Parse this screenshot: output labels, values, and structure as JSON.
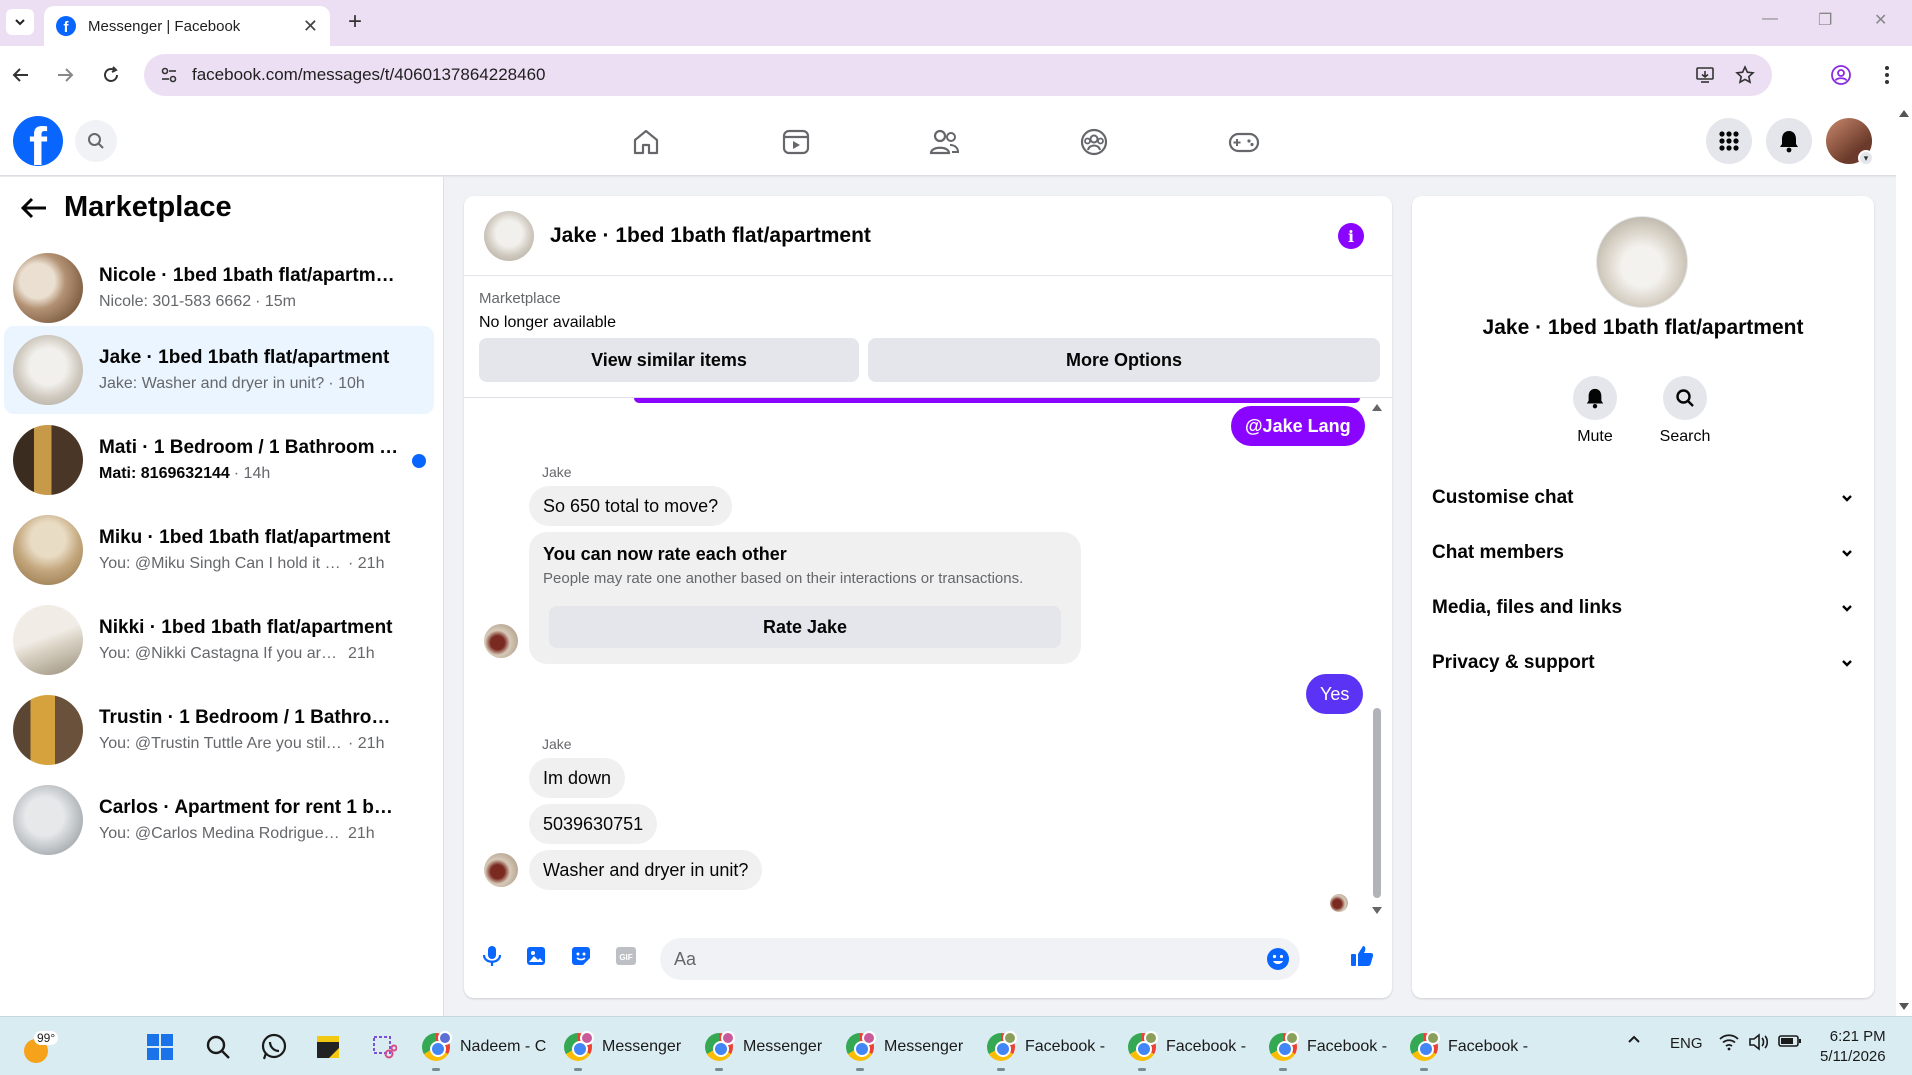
{
  "browser": {
    "tab_title": "Messenger | Facebook",
    "url": "facebook.com/messages/t/4060137864228460"
  },
  "fb": {
    "nav_icons": [
      "home-icon",
      "watch-icon",
      "friends-icon",
      "groups-icon",
      "gaming-icon"
    ]
  },
  "sidebar": {
    "title": "Marketplace",
    "conversations": [
      {
        "name": "Nicole · 1bed 1bath flat/apartment",
        "preview": "Nicole: 301-583 6662",
        "time": "· 15m",
        "unread": false
      },
      {
        "name": "Jake · 1bed 1bath flat/apartment",
        "preview": "Jake: Washer and dryer in unit?",
        "time": "· 10h",
        "unread": false
      },
      {
        "name": "Mati · 1 Bedroom / 1 Bathroom A...",
        "preview": "Mati: 8169632144",
        "time": "· 14h",
        "unread": true
      },
      {
        "name": "Miku · 1bed 1bath flat/apartment",
        "preview": "You: @Miku Singh Can I hold it for y...",
        "time": "· 21h",
        "unread": false
      },
      {
        "name": "Nikki · 1bed 1bath flat/apartment",
        "preview": "You: @Nikki Castagna If you are inter...",
        "time": "21h",
        "unread": false
      },
      {
        "name": "Trustin · 1 Bedroom / 1 Bathroom ...",
        "preview": "You: @Trustin Tuttle Are you still inte...",
        "time": "· 21h",
        "unread": false
      },
      {
        "name": "Carlos · Apartment for rent 1 beds ...",
        "preview": "You: @Carlos Medina Rodriguez If y...",
        "time": "21h",
        "unread": false
      }
    ]
  },
  "chat": {
    "title": "Jake · 1bed 1bath flat/apartment",
    "banner_label": "Marketplace",
    "banner_status": "No longer available",
    "btn_similar": "View similar items",
    "btn_more": "More Options",
    "mention_bubble": "@Jake Lang",
    "sender_1": "Jake",
    "msg_1": "So 650 total to move?",
    "rate_title": "You can now rate each other",
    "rate_sub": "People may rate one another based on their interactions or transactions.",
    "rate_btn": "Rate Jake",
    "reply_yes": "Yes",
    "sender_2": "Jake",
    "msg_2": "Im down",
    "msg_3": "5039630751",
    "msg_4": "Washer and dryer in unit?",
    "composer_placeholder": "Aa",
    "accent_purple": "#8a05ff",
    "accent_blue": "#5b33f5"
  },
  "info_panel": {
    "title": "Jake · 1bed 1bath flat/apartment",
    "mute_label": "Mute",
    "search_label": "Search",
    "sections": [
      "Customise chat",
      "Chat members",
      "Media, files and links",
      "Privacy & support"
    ]
  },
  "taskbar": {
    "temperature": "99°",
    "apps": [
      "Nadeem - C",
      "Messenger",
      "Messenger",
      "Messenger",
      "Facebook -",
      "Facebook -",
      "Facebook -",
      "Facebook -"
    ],
    "language": "ENG",
    "time": "6:21 PM",
    "date": "5/11/2026"
  }
}
